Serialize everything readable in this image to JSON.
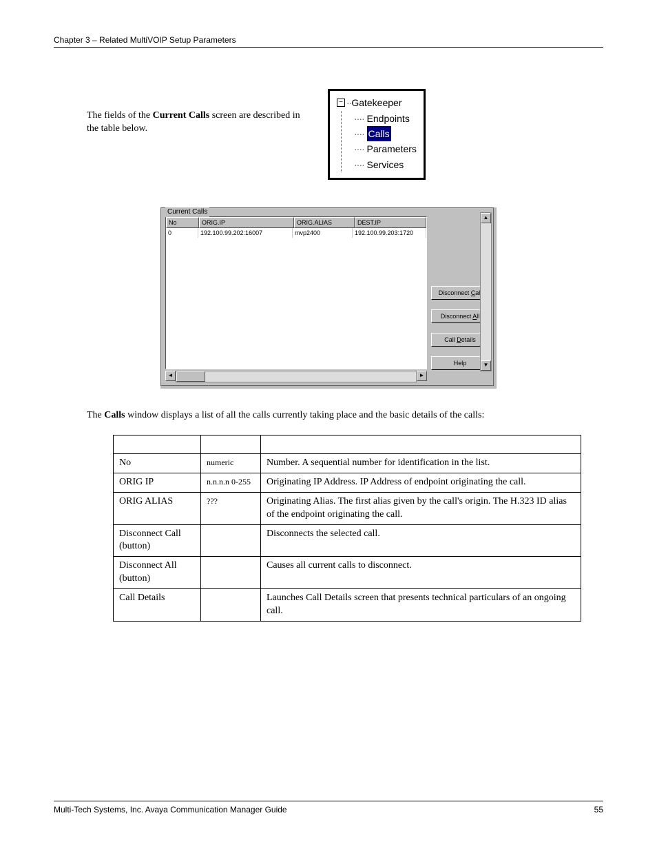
{
  "header": {
    "chapter": "Chapter 3 – Related MultiVOIP Setup Parameters"
  },
  "intro": {
    "text_pre": "The fields of the ",
    "text_bold": "Current Calls",
    "text_post": " screen are described in the table below."
  },
  "tree": {
    "root": "Gatekeeper",
    "items": [
      "Endpoints",
      "Calls",
      "Parameters",
      "Services"
    ],
    "selected": "Calls"
  },
  "calls_panel": {
    "legend": "Current Calls",
    "columns": [
      "No",
      "ORIG.IP",
      "ORIG.ALIAS",
      "DEST.IP"
    ],
    "col_widths": [
      "40px",
      "130px",
      "80px",
      "140px"
    ],
    "rows": [
      {
        "No": "0",
        "ORIG_IP": "192.100.99.202:16007",
        "ORIG_ALIAS": "mvp2400",
        "DEST_IP": "192.100.99.203:1720"
      }
    ],
    "buttons": {
      "disconnect_call": "Disconnect Call",
      "disconnect_all": "Disconnect All",
      "call_details": "Call Details",
      "help": "Help"
    }
  },
  "desc": {
    "pre": "The ",
    "bold": "Calls",
    "post": " window displays a list of all the calls currently taking place and the basic details of the calls:"
  },
  "table": [
    {
      "c1": "No",
      "c2": "numeric",
      "c3": "Number. A sequential number for identification in the list."
    },
    {
      "c1": "ORIG IP",
      "c2": "n.n.n.n 0-255",
      "c3": "Originating IP Address.  IP Address of endpoint originating the call."
    },
    {
      "c1": "ORIG ALIAS",
      "c2": "???",
      "c3": "Originating Alias.  The first alias given by the call's origin.  The H.323 ID alias of the endpoint originating the call."
    },
    {
      "c1": "Disconnect Call (button)",
      "c2": "",
      "c3": "Disconnects the selected call."
    },
    {
      "c1": "Disconnect All (button)",
      "c2": "",
      "c3": "Causes all current calls to disconnect."
    },
    {
      "c1": "Call Details",
      "c2": "",
      "c3": "Launches Call Details screen that presents technical particulars of an ongoing call."
    }
  ],
  "footer": {
    "text": "Multi-Tech Systems, Inc. Avaya Communication Manager Guide",
    "page": "55"
  }
}
